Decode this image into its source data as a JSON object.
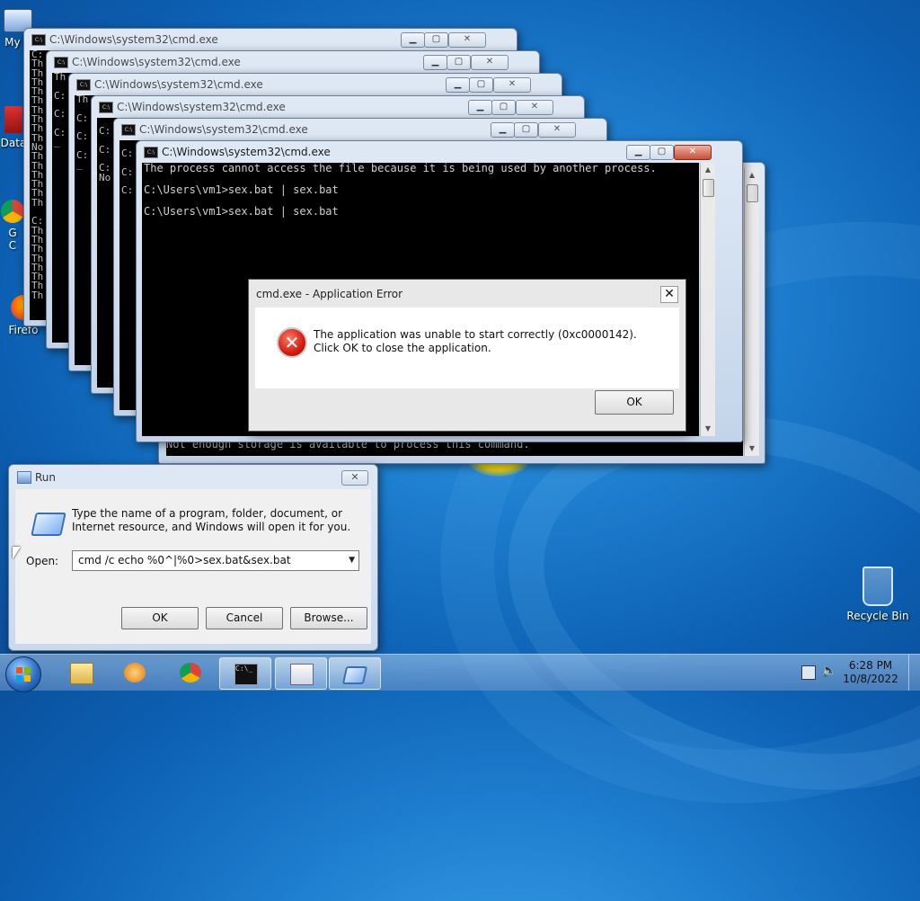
{
  "desktop": {
    "icons": [
      {
        "label": "My C"
      },
      {
        "label": "Data"
      },
      {
        "label": "G"
      },
      {
        "label": "C"
      },
      {
        "label": "Firefo"
      },
      {
        "label": "Recycle Bin"
      }
    ]
  },
  "cmd_windows": [
    {
      "title": "C:\\Windows\\system32\\cmd.exe",
      "lines": [
        "C:",
        "Th",
        "Th",
        "Th",
        "Th",
        "Th",
        "Th",
        "Th",
        "Th",
        "Th",
        "No",
        "Th",
        "Th",
        "Th",
        "Th",
        "Th",
        "Th",
        "",
        "C:",
        "Th",
        "Th",
        "Th",
        "Th",
        "Th",
        "Th",
        "Th",
        "Th"
      ]
    },
    {
      "title": "C:\\Windows\\system32\\cmd.exe",
      "lines": [
        "Th",
        "",
        "C:",
        "",
        "C:",
        "",
        "C:",
        "_"
      ]
    },
    {
      "title": "C:\\Windows\\system32\\cmd.exe",
      "lines": [
        "Th",
        "",
        "C:",
        "",
        "C:",
        "",
        "C:",
        "_"
      ]
    },
    {
      "title": "C:\\Windows\\system32\\cmd.exe",
      "lines": [
        "",
        "C:",
        "",
        "C:",
        "",
        "C:",
        "No"
      ]
    },
    {
      "title": "C:\\Windows\\system32\\cmd.exe",
      "lines": [
        "",
        "C:",
        "",
        "C:",
        "",
        "C:"
      ]
    },
    {
      "title": "C:\\Windows\\system32\\cmd.exe",
      "lines": [
        "The process cannot access the file because it is being used by another process.",
        "",
        "C:\\Users\\vm1>sex.bat | sex.bat",
        "",
        "C:\\Users\\vm1>sex.bat | sex.bat"
      ]
    }
  ],
  "back_console_fragment": "Not enough storage is available to process this command.",
  "error_dialog": {
    "title": "cmd.exe - Application Error",
    "close": "✕",
    "message": "The application was unable to start correctly (0xc0000142). Click OK to close the application.",
    "ok": "OK"
  },
  "run_dialog": {
    "title": "Run",
    "close": "✕",
    "message": "Type the name of a program, folder, document, or Internet resource, and Windows will open it for you.",
    "open_label": "Open:",
    "open_value": "cmd /c echo %0^|%0>sex.bat&sex.bat",
    "ok": "OK",
    "cancel": "Cancel",
    "browse": "Browse..."
  },
  "taskbar": {
    "time": "6:28 PM",
    "date": "10/8/2022"
  }
}
